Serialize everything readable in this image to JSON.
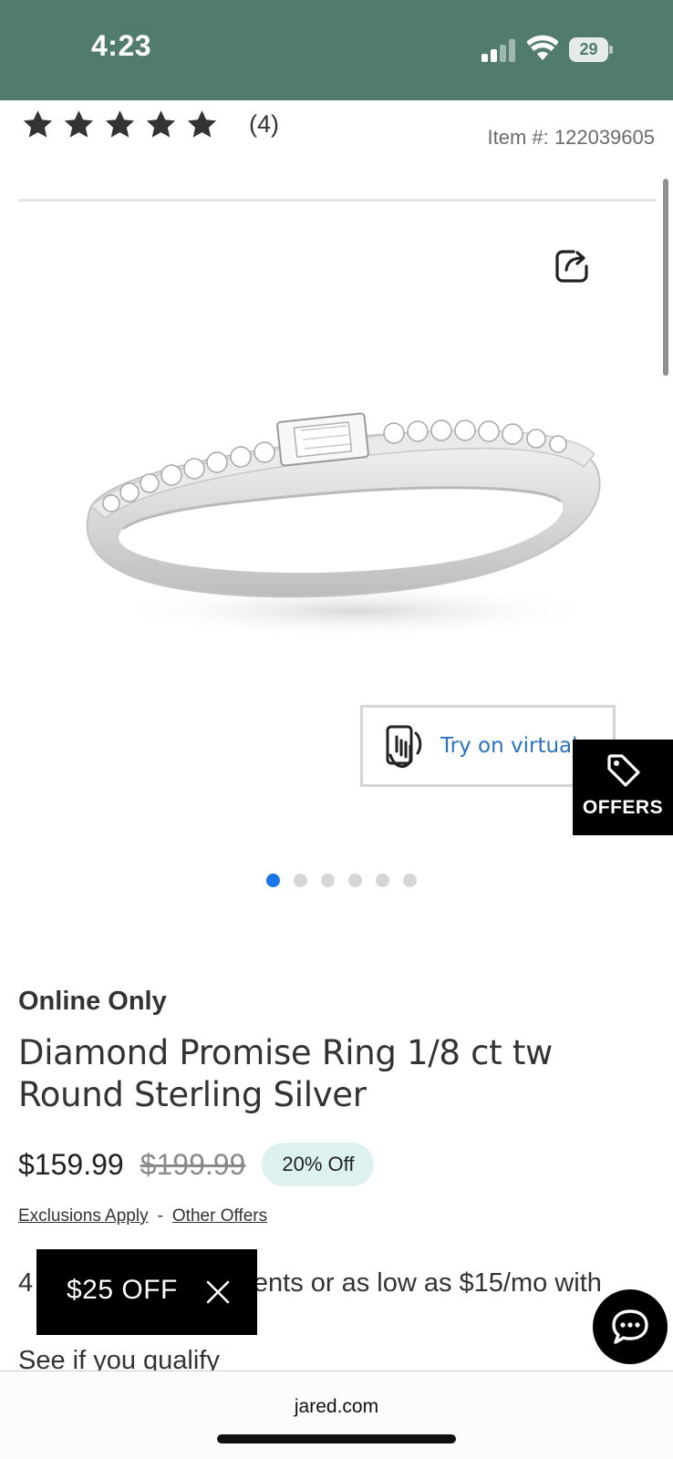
{
  "status_bar": {
    "time": "4:23",
    "battery": "29"
  },
  "product": {
    "rating": 5,
    "review_count": "(4)",
    "item_number": "Item #: 122039605",
    "badge": "Online Only",
    "title": "Diamond Promise Ring 1/8 ct tw Round Sterling Silver",
    "price": "$159.99",
    "original_price": "$199.99",
    "discount": "20% Off",
    "exclusions_link": "Exclusions Apply",
    "separator": "-",
    "other_offers_link": "Other Offers",
    "financing_text": "4 interest-free payments or as low as $15/mo with",
    "qualify_link": "See if you qualify"
  },
  "gallery": {
    "image_count": 6,
    "active_index": 0
  },
  "try_on": {
    "label": "Try on virtually"
  },
  "offers_tab": {
    "label": "OFFERS"
  },
  "promo": {
    "label": "$25 OFF"
  },
  "browser": {
    "url": "jared.com"
  },
  "colors": {
    "status_bar": "#517c6c",
    "link_blue": "#2a73c0",
    "active_dot": "#1a73e8",
    "badge_bg": "#ddf2ef"
  }
}
